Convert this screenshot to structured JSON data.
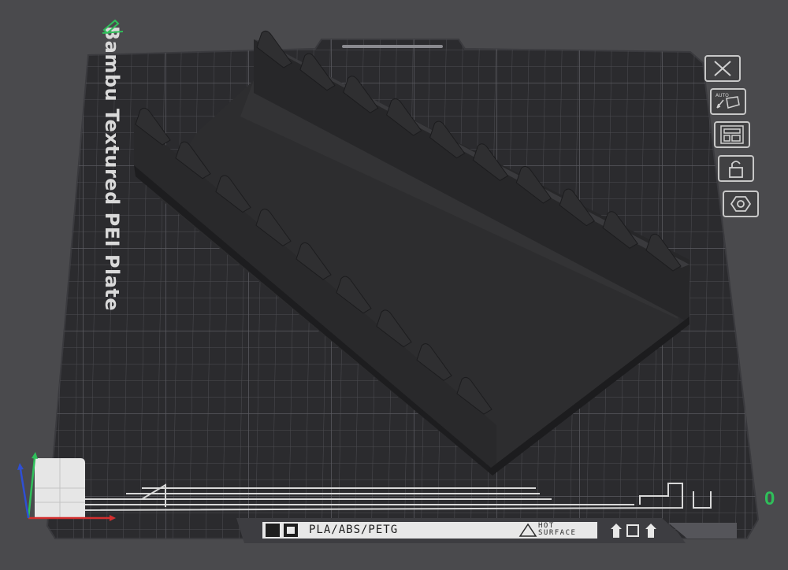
{
  "plate": {
    "title": "Bambu Textured PEI Plate",
    "filament_types": "PLA/ABS/PETG",
    "hot_surface": [
      "HOT",
      "SURFACE"
    ]
  },
  "toolbar": {
    "buttons": [
      {
        "name": "close-plate",
        "icon": "close-icon"
      },
      {
        "name": "auto-orient",
        "icon": "auto-orient-icon",
        "label": "AUTO"
      },
      {
        "name": "arrange",
        "icon": "arrange-icon"
      },
      {
        "name": "lock",
        "icon": "lock-icon"
      },
      {
        "name": "plate-settings",
        "icon": "gear-hex-icon"
      }
    ]
  },
  "viewport": {
    "object": "tray with slotted side walls",
    "corner_readout": "0",
    "colors": {
      "background": "#4a4a4d",
      "plate": "#2b2b2e",
      "grid": "#55555a",
      "object": "#2e2e30",
      "accent_green": "#2fbf5a",
      "axis_x": "#d32f2f",
      "axis_y": "#2fbf5a",
      "axis_z": "#2f4fd3"
    }
  }
}
